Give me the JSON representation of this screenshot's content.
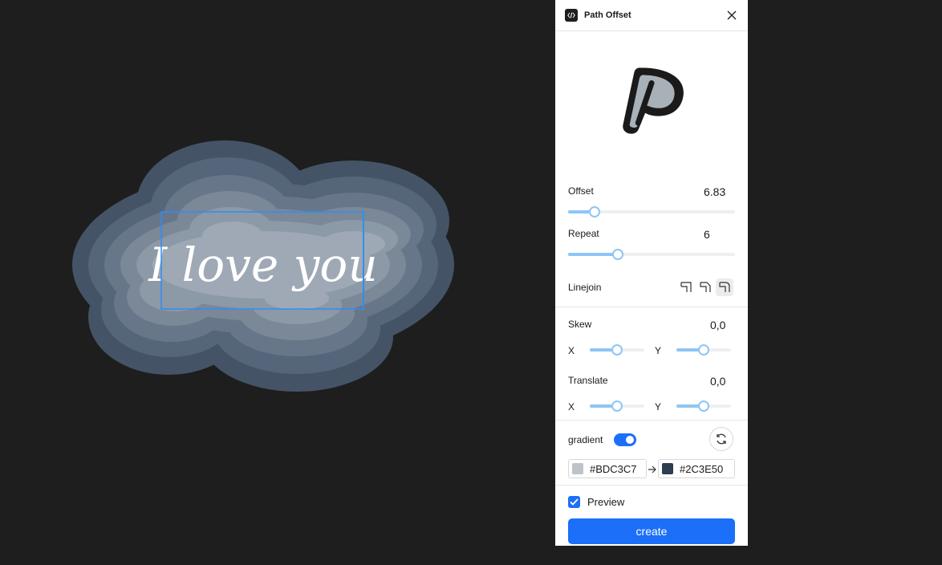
{
  "panel": {
    "title": "Path Offset",
    "offset": {
      "label": "Offset",
      "value": "6.83",
      "level": 0.16
    },
    "repeat": {
      "label": "Repeat",
      "value": "6",
      "level": 0.3
    },
    "linejoin": {
      "label": "Linejoin",
      "options": [
        "miter-icon",
        "bevel-icon",
        "round-icon"
      ],
      "selected": "round-icon"
    },
    "skew": {
      "label": "Skew",
      "value": "0,0",
      "x_label": "X",
      "y_label": "Y",
      "x_level": 0.5,
      "y_level": 0.5
    },
    "translate": {
      "label": "Translate",
      "value": "0,0",
      "x_label": "X",
      "y_label": "Y",
      "x_level": 0.5,
      "y_level": 0.5
    },
    "gradient": {
      "label": "gradient",
      "enabled": true,
      "from": "#BDC3C7",
      "to": "#2C3E50"
    },
    "preview": {
      "label": "Preview",
      "checked": true
    },
    "create_label": "create"
  },
  "canvas": {
    "text": "I love you"
  },
  "colors": {
    "accent": "#1c6ff8",
    "slider": "#8ec5f6",
    "canvas_bg": "#1e1e1e",
    "gradient_start": "#BDC3C7",
    "gradient_end": "#2C3E50"
  }
}
